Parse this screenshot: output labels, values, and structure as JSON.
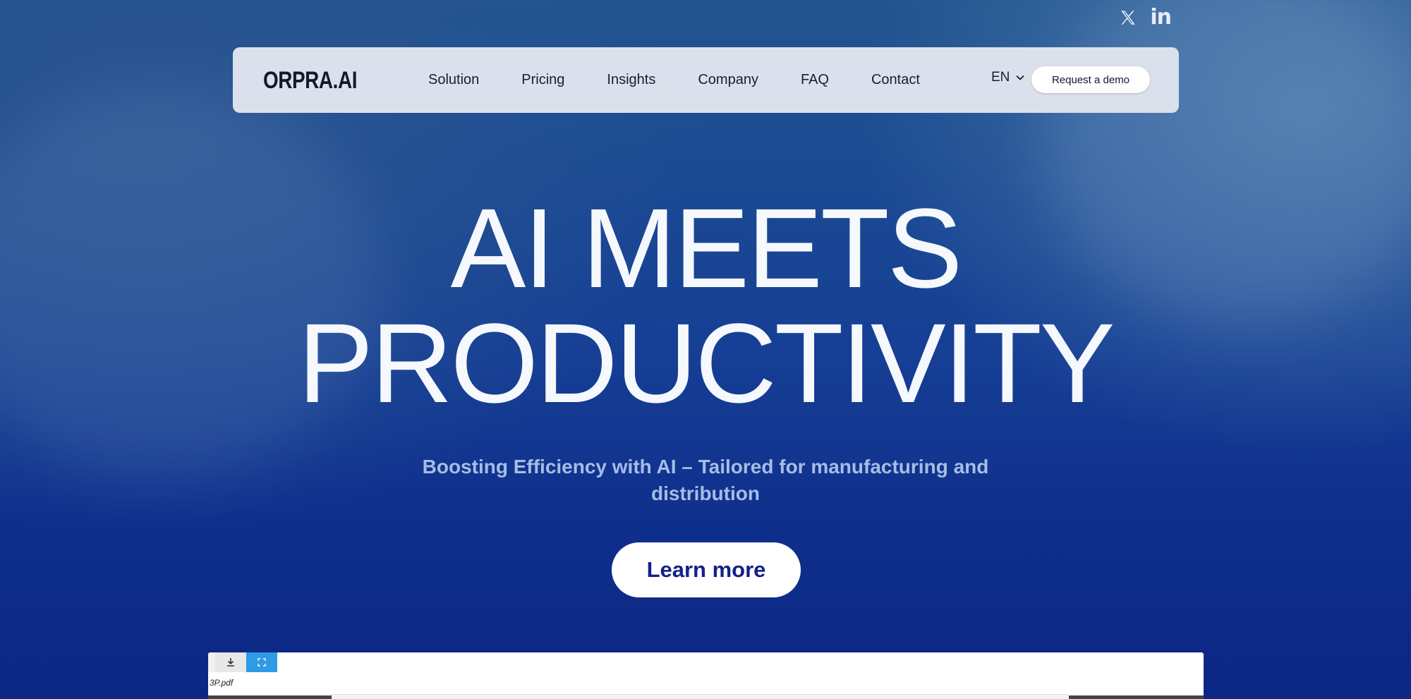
{
  "social": {
    "items": [
      {
        "icon": "x-icon",
        "label": "X"
      },
      {
        "icon": "linkedin-icon",
        "label": "in"
      }
    ]
  },
  "nav": {
    "logo": "ORPRA.AI",
    "links": [
      {
        "label": "Solution"
      },
      {
        "label": "Pricing"
      },
      {
        "label": "Insights"
      },
      {
        "label": "Company"
      },
      {
        "label": "FAQ"
      },
      {
        "label": "Contact"
      }
    ],
    "language": "EN",
    "cta_label": "Request a demo"
  },
  "hero": {
    "title_line1": "AI MEETS",
    "title_line2": "PRODUCTIVITY",
    "subtitle": "Boosting Efficiency with AI – Tailored for manufacturing and distribution",
    "button_label": "Learn more"
  },
  "viewer": {
    "filename": "3P.pdf",
    "download_icon": "download-icon",
    "fullscreen_icon": "fullscreen-icon"
  },
  "colors": {
    "background_top": "#21558f",
    "background_bottom": "#0c2684",
    "nav_bg": "#dbe1ec",
    "button_text": "#14208a",
    "subtitle": "#a6bde4",
    "fullscreen_btn": "#2e9be6"
  }
}
